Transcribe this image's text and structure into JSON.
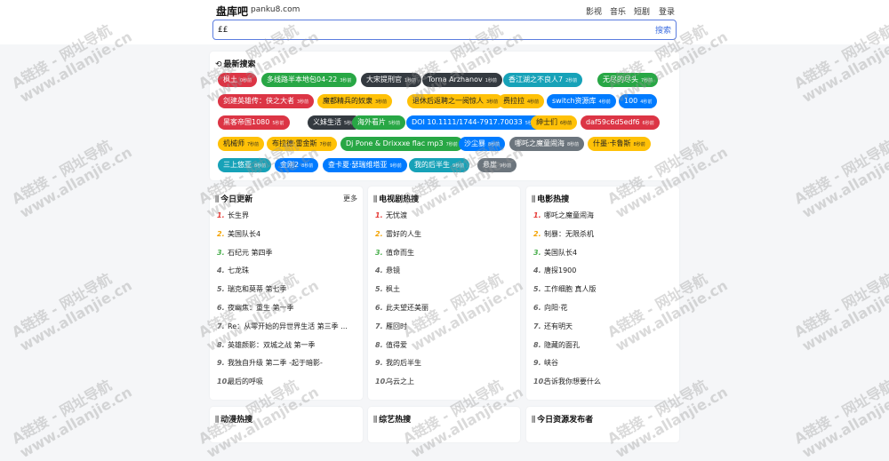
{
  "header": {
    "brand": "盘库吧",
    "domain": "panku8.com",
    "nav": [
      "影视",
      "音乐",
      "短剧",
      "登录"
    ]
  },
  "search": {
    "value": "££",
    "button": "搜索"
  },
  "hot_search": {
    "title": "最新搜索",
    "tags": [
      {
        "label": "枫土",
        "count": "0秒前",
        "color": "#dc3545",
        "fg": "#fff"
      },
      {
        "label": "多线路半本地包04-22",
        "count": "3秒前",
        "color": "#28a745",
        "fg": "#fff"
      },
      {
        "label": "大宋提刑官",
        "count": "1秒前",
        "color": "#343a40",
        "fg": "#fff"
      },
      {
        "label": "Torna Arzhanov",
        "count": "1秒前",
        "color": "#343a40",
        "fg": "#fff"
      },
      {
        "label": "香江湖之不良人7",
        "count": "2秒前",
        "color": "#17a2b8",
        "fg": "#fff"
      },
      {
        "label": "无尽的尽头",
        "count": "7秒前",
        "color": "#28a745",
        "fg": "#fff"
      },
      {
        "label": "剑建英雄传：侠之大者",
        "count": "3秒前",
        "color": "#dc3545",
        "fg": "#fff"
      },
      {
        "label": "魔都精兵的奴隶",
        "count": "3秒前",
        "color": "#ffc107",
        "fg": "#222"
      },
      {
        "label": "退休后返聘之一阅惊人",
        "count": "3秒前",
        "color": "#ffc107",
        "fg": "#222"
      },
      {
        "label": "费拉拉",
        "count": "4秒前",
        "color": "#ffc107",
        "fg": "#222"
      },
      {
        "label": "switch资源库",
        "count": "4秒前",
        "color": "#007bff",
        "fg": "#fff"
      },
      {
        "label": "100",
        "count": "4秒前",
        "color": "#007bff",
        "fg": "#fff"
      },
      {
        "label": "黑客帝国1080",
        "count": "5秒前",
        "color": "#dc3545",
        "fg": "#fff"
      },
      {
        "label": "义妹生活",
        "count": "5秒前",
        "color": "#343a40",
        "fg": "#fff"
      },
      {
        "label": "海外看片",
        "count": "5秒前",
        "color": "#28a745",
        "fg": "#fff"
      },
      {
        "label": "DOI 10.1111/1744-7917.70033",
        "count": "5秒前",
        "color": "#007bff",
        "fg": "#fff"
      },
      {
        "label": "绅士们",
        "count": "6秒前",
        "color": "#ffc107",
        "fg": "#222"
      },
      {
        "label": "daf59c6d5edf6",
        "count": "6秒前",
        "color": "#dc3545",
        "fg": "#fff"
      },
      {
        "label": "机械师",
        "count": "7秒前",
        "color": "#ffc107",
        "fg": "#222"
      },
      {
        "label": "布拉德·雷金斯",
        "count": "7秒前",
        "color": "#ffc107",
        "fg": "#222"
      },
      {
        "label": "Dj Pone & Drixxxe flac mp3",
        "count": "7秒前",
        "color": "#28a745",
        "fg": "#fff"
      },
      {
        "label": "沙尘暴",
        "count": "8秒前",
        "color": "#007bff",
        "fg": "#fff"
      },
      {
        "label": "哪吒之魔童闹海",
        "count": "8秒前",
        "color": "#6c757d",
        "fg": "#fff"
      },
      {
        "label": "什墨·卡鲁斯",
        "count": "8秒前",
        "color": "#ffc107",
        "fg": "#222"
      },
      {
        "label": "三上悠亚",
        "count": "8秒前",
        "color": "#17a2b8",
        "fg": "#fff"
      },
      {
        "label": "金刚2",
        "count": "8秒前",
        "color": "#007bff",
        "fg": "#fff"
      },
      {
        "label": "查卡夏·瑟瑞维塔亚",
        "count": "9秒前",
        "color": "#007bff",
        "fg": "#fff"
      },
      {
        "label": "我的后半生",
        "count": "9秒前",
        "color": "#17a2b8",
        "fg": "#fff"
      },
      {
        "label": "悬崖",
        "count": "9秒前",
        "color": "#6c757d",
        "fg": "#fff"
      }
    ]
  },
  "columns": [
    {
      "title": "今日更新",
      "more": "更多",
      "items": [
        "长生界",
        "美国队长4",
        "石纪元 第四季",
        "七龙珠",
        "瑞克和莫蒂 第七季",
        "夜幽焦：重生 第一季",
        "Re：从零开始的异世界生活 第三季 ...",
        "英雄颜影：双城之战 第一季",
        "我独自升级 第二季 -起于暗影-",
        "最后的呼吸"
      ]
    },
    {
      "title": "电视剧热搜",
      "more": "",
      "items": [
        "无忧渡",
        "雷好的人生",
        "值命而生",
        "悬镜",
        "枫土",
        "此夫望还美丽",
        "雁回时",
        "值得爱",
        "我的后半生",
        "乌云之上"
      ]
    },
    {
      "title": "电影热搜",
      "more": "",
      "items": [
        "哪吒之魔童闹海",
        "制暴：无限杀机",
        "美国队长4",
        "唐探1900",
        "工作细胞 真人版",
        "向阳·花",
        "还有明天",
        "隐藏的面孔",
        "峡谷",
        "告诉我你想要什么"
      ]
    },
    {
      "title": "动漫热搜",
      "more": "",
      "items": []
    },
    {
      "title": "综艺热搜",
      "more": "",
      "items": []
    },
    {
      "title": "今日资源发布者",
      "more": "",
      "items": []
    }
  ],
  "watermark": {
    "line1": "A链接 - 网址导航",
    "line2": "www.allanjie.cn"
  }
}
